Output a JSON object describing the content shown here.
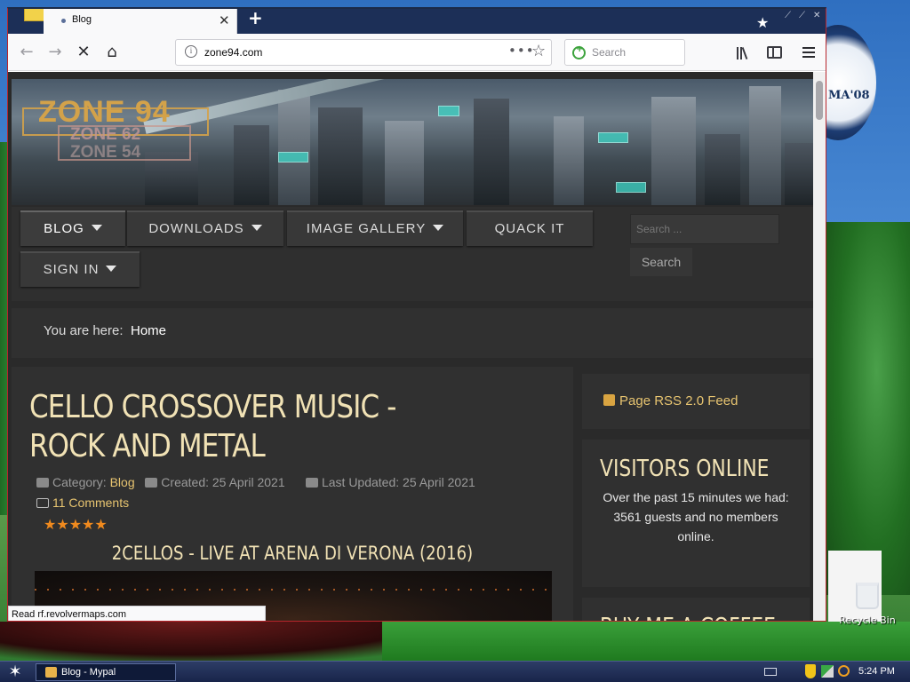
{
  "browser": {
    "tab_title": "Blog",
    "url": "zone94.com",
    "search_placeholder": "Search",
    "status_text": "Read rf.revolvermaps.com"
  },
  "site": {
    "logo": {
      "main": "ZONE 94",
      "sub1": "ZONE 62",
      "sub2": "ZONE 54"
    },
    "menu": [
      {
        "label": "BLOG"
      },
      {
        "label": "DOWNLOADS"
      },
      {
        "label": "IMAGE GALLERY"
      },
      {
        "label": "QUACK IT"
      },
      {
        "label": "SIGN IN"
      }
    ],
    "search_placeholder": "Search ...",
    "search_button": "Search",
    "breadcrumb": {
      "label": "You are here:",
      "home": "Home"
    }
  },
  "article": {
    "title": "CELLO CROSSOVER MUSIC - ROCK AND METAL",
    "category_label": "Category:",
    "category": "Blog",
    "created": "Created: 25 April 2021",
    "updated": "Last Updated: 25 April 2021",
    "comments": "11 Comments",
    "rating_stars": "★★★★★",
    "video_title": "2CELLOS - LIVE AT ARENA DI VERONA (2016)"
  },
  "sidebar": {
    "rss": "Page RSS 2.0 Feed",
    "visitors_title": "VISITORS ONLINE",
    "visitors_line1": "Over the past 15 minutes we had:",
    "visitors_line2": "3561 guests and no members online.",
    "coffee_title": "BUY ME A COFFEE"
  },
  "desktop": {
    "obama_text": "MA'08",
    "recycle_bin": "Recycle Bin"
  },
  "taskbar": {
    "task_label": "Blog - Mypal",
    "clock": "5:24 PM"
  }
}
